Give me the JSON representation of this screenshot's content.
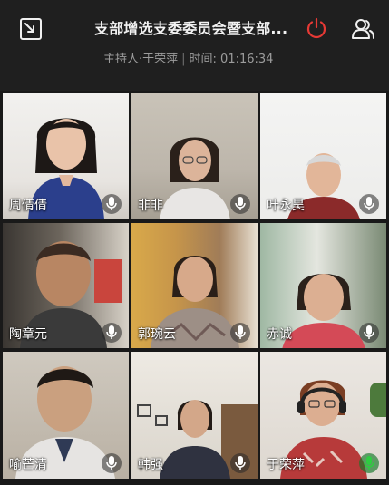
{
  "header": {
    "title": "支部增选支委委员会暨支部...",
    "host_label": "主持人·于荣萍",
    "time_label": "时间: 01:16:34"
  },
  "icons": {
    "minimize": "minimize-window-icon",
    "power": "power-icon",
    "members": "members-icon",
    "mic": "microphone-icon"
  },
  "colors": {
    "power_red": "#e53935",
    "mic_active": "#2ecc40"
  },
  "participants": [
    {
      "name": "周倩倩",
      "mic_active": false
    },
    {
      "name": "非非",
      "mic_active": false
    },
    {
      "name": "叶永昊",
      "mic_active": false
    },
    {
      "name": "陶章元",
      "mic_active": false
    },
    {
      "name": "郭琬云",
      "mic_active": false
    },
    {
      "name": "赤诚",
      "mic_active": false
    },
    {
      "name": "喻芒清",
      "mic_active": false
    },
    {
      "name": "韩强",
      "mic_active": false
    },
    {
      "name": "于荣萍",
      "mic_active": true
    }
  ]
}
